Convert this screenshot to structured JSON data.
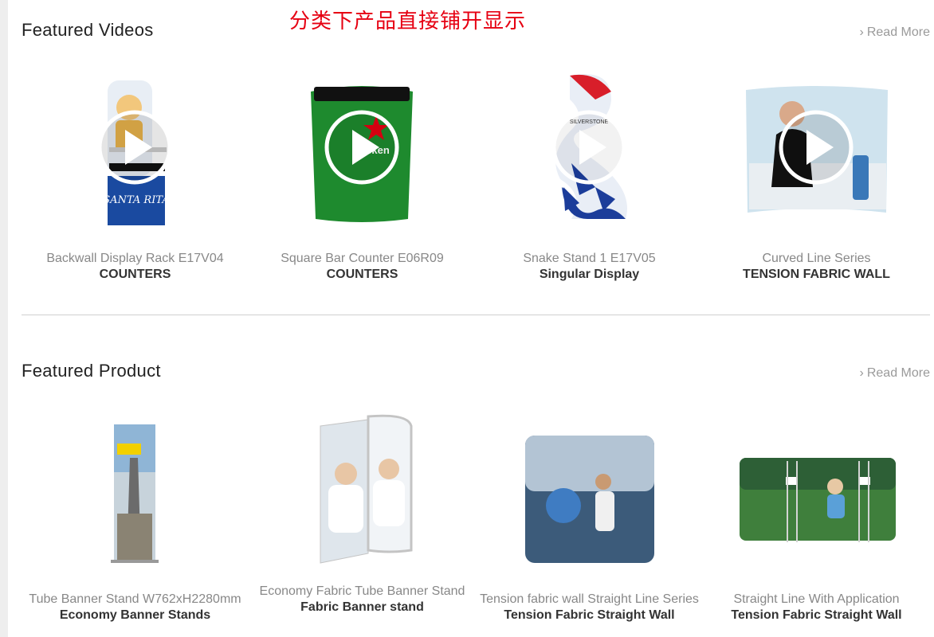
{
  "annotation": "分类下产品直接铺开显示",
  "featured_videos": {
    "title": "Featured Videos",
    "read_more": "Read More",
    "items": [
      {
        "name": "Backwall Display Rack E17V04",
        "category": "COUNTERS",
        "icon": "play-icon"
      },
      {
        "name": "Square Bar Counter E06R09",
        "category": "COUNTERS",
        "icon": "play-icon"
      },
      {
        "name": "Snake Stand 1 E17V05",
        "category": "Singular Display",
        "icon": "play-icon"
      },
      {
        "name": "Curved Line Series",
        "category": "TENSION FABRIC WALL",
        "icon": "play-icon"
      }
    ]
  },
  "featured_product": {
    "title": "Featured Product",
    "read_more": "Read More",
    "items": [
      {
        "name": "Tube Banner Stand W762xH2280mm",
        "category": "Economy Banner Stands"
      },
      {
        "name": "Economy Fabric Tube Banner Stand",
        "category": "Fabric Banner stand"
      },
      {
        "name": "Tension fabric wall Straight Line Series",
        "category": "Tension Fabric Straight Wall"
      },
      {
        "name": "Straight Line With Application",
        "category": "Tension Fabric Straight Wall"
      }
    ]
  },
  "colors": {
    "annotation": "#e60012",
    "read_more": "#9a9a9a",
    "heineken_green": "#1e8a2e"
  }
}
